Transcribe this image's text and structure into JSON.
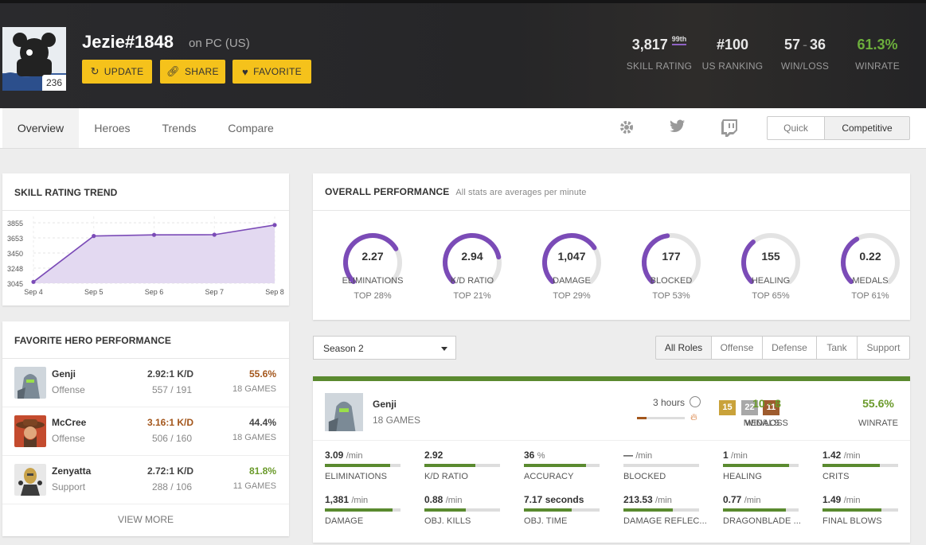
{
  "profile": {
    "name": "Jezie#1848",
    "platform": "on PC (US)",
    "level": "236",
    "buttons": {
      "update": "UPDATE",
      "share": "SHARE",
      "favorite": "FAVORITE"
    },
    "stats": {
      "skill_rating": {
        "value": "3,817",
        "badge": "99th",
        "label": "SKILL RATING"
      },
      "ranking": {
        "value": "#100",
        "label": "US RANKING"
      },
      "winloss": {
        "wins": "57",
        "sep": "-",
        "losses": "36",
        "label": "WIN/LOSS"
      },
      "winrate": {
        "value": "61.3%",
        "label": "WINRATE"
      }
    }
  },
  "colors": {
    "accent": "#7b4bb7",
    "yellow": "#f5c21b",
    "green": "#5a8a2f",
    "orange": "#a3561b",
    "win_green": "#6a9a2a"
  },
  "nav": {
    "tabs": [
      "Overview",
      "Heroes",
      "Trends",
      "Compare"
    ],
    "icons": [
      "gear-icon",
      "twitter-icon",
      "twitch-icon"
    ],
    "modes": [
      "Quick",
      "Competitive"
    ]
  },
  "trend": {
    "title": "SKILL RATING TREND",
    "chart_data": {
      "type": "area",
      "x": [
        "Sep 4",
        "Sep 5",
        "Sep 6",
        "Sep 7",
        "Sep 8"
      ],
      "values": [
        3063,
        3678,
        3693,
        3695,
        3825
      ],
      "yticks": [
        "3855",
        "3653",
        "3450",
        "3248",
        "3045"
      ],
      "ylim": [
        3045,
        3855
      ],
      "grid": true
    }
  },
  "favorite": {
    "title": "FAVORITE HERO PERFORMANCE",
    "heroes": [
      {
        "name": "Genji",
        "role": "Offense",
        "kd": "2.92:1 K/D",
        "kd_raw": "557 / 191",
        "winrate": "55.6%",
        "games": "18 GAMES",
        "kd_color": "#444",
        "wr_color": "#a3561b"
      },
      {
        "name": "McCree",
        "role": "Offense",
        "kd": "3.16:1 K/D",
        "kd_raw": "506 / 160",
        "winrate": "44.4%",
        "games": "18 GAMES",
        "kd_color": "#a3561b",
        "wr_color": "#444"
      },
      {
        "name": "Zenyatta",
        "role": "Support",
        "kd": "2.72:1 K/D",
        "kd_raw": "288 / 106",
        "winrate": "81.8%",
        "games": "11 GAMES",
        "kd_color": "#444",
        "wr_color": "#6a9a2a"
      }
    ],
    "view_more": "VIEW MORE"
  },
  "overall": {
    "title": "OVERALL PERFORMANCE",
    "subtitle": "All stats are averages per minute",
    "gauges": [
      {
        "value": "2.27",
        "label": "ELIMINATIONS",
        "top": "TOP 28%",
        "fill": 0.72
      },
      {
        "value": "2.94",
        "label": "K/D RATIO",
        "top": "TOP 21%",
        "fill": 0.79
      },
      {
        "value": "1,047",
        "label": "DAMAGE",
        "top": "TOP 29%",
        "fill": 0.71
      },
      {
        "value": "177",
        "label": "BLOCKED",
        "top": "TOP 53%",
        "fill": 0.47
      },
      {
        "value": "155",
        "label": "HEALING",
        "top": "TOP 65%",
        "fill": 0.35
      },
      {
        "value": "0.22",
        "label": "MEDALS",
        "top": "TOP 61%",
        "fill": 0.39
      }
    ]
  },
  "filters": {
    "season": "Season 2",
    "roles": [
      "All Roles",
      "Offense",
      "Defense",
      "Tank",
      "Support"
    ]
  },
  "hero_detail": {
    "name": "Genji",
    "games": "18 GAMES",
    "time": "3 hours",
    "medals": {
      "gold": "15",
      "silver": "22",
      "bronze": "11",
      "label": "MEDALS"
    },
    "winloss": {
      "value": "10 - 8",
      "label": "WIN/LOSS"
    },
    "winrate": {
      "value": "55.6%",
      "label": "WINRATE"
    },
    "stats": [
      {
        "value": "3.09",
        "unit": "/min",
        "label": "ELIMINATIONS",
        "fill": 0.86
      },
      {
        "value": "2.92",
        "unit": "",
        "label": "K/D RATIO",
        "fill": 0.67
      },
      {
        "value": "36",
        "unit": "%",
        "label": "ACCURACY",
        "fill": 0.82
      },
      {
        "value": "—",
        "unit": "/min",
        "label": "BLOCKED",
        "fill": 0
      },
      {
        "value": "1",
        "unit": "/min",
        "label": "HEALING",
        "fill": 0.87
      },
      {
        "value": "1.42",
        "unit": "/min",
        "label": "CRITS",
        "fill": 0.76
      },
      {
        "value": "1,381",
        "unit": "/min",
        "label": "DAMAGE",
        "fill": 0.89
      },
      {
        "value": "0.88",
        "unit": "/min",
        "label": "OBJ. KILLS",
        "fill": 0.55
      },
      {
        "value": "7.17 seconds",
        "unit": "",
        "label": "OBJ. TIME",
        "fill": 0.63
      },
      {
        "value": "213.53",
        "unit": "/min",
        "label": "DAMAGE REFLEC...",
        "fill": 0.65
      },
      {
        "value": "0.77",
        "unit": "/min",
        "label": "DRAGONBLADE ...",
        "fill": 0.83
      },
      {
        "value": "1.49",
        "unit": "/min",
        "label": "FINAL BLOWS",
        "fill": 0.78
      }
    ]
  }
}
